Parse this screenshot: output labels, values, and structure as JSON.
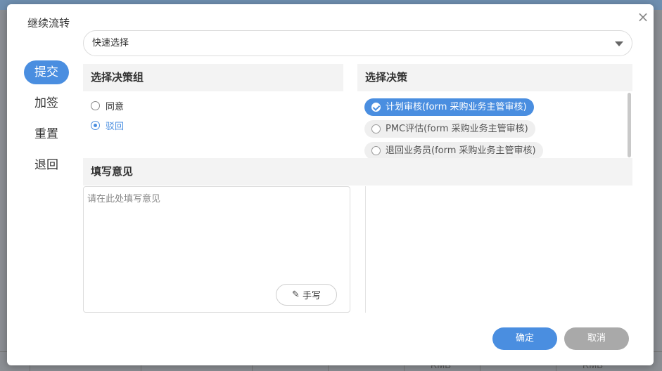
{
  "dialog": {
    "title": "继续流转",
    "close_glyph": "×"
  },
  "nav": {
    "items": [
      {
        "label": "提交",
        "active": true
      },
      {
        "label": "加签",
        "active": false
      },
      {
        "label": "重置",
        "active": false
      },
      {
        "label": "退回",
        "active": false
      }
    ]
  },
  "quick_select": {
    "value": "快速选择"
  },
  "decision_group": {
    "header": "选择决策组",
    "options": [
      {
        "label": "同意",
        "checked": false
      },
      {
        "label": "驳回",
        "checked": true
      }
    ]
  },
  "decision": {
    "header": "选择决策",
    "options": [
      {
        "label": "计划审核(form 采购业务主管审核)",
        "selected": true
      },
      {
        "label": "PMC评估(form 采购业务主管审核)",
        "selected": false
      },
      {
        "label": "退回业务员(form 采购业务主管审核)",
        "selected": false
      }
    ]
  },
  "opinion": {
    "header": "填写意见",
    "placeholder": "请在此处填写意见",
    "value": "",
    "handwrite_label": "手写"
  },
  "footer": {
    "ok_label": "确定",
    "cancel_label": "取消"
  },
  "background": {
    "rmb_label_1": "RMB",
    "rmb_label_2": "RMB"
  },
  "colors": {
    "accent": "#4a8ee0",
    "cancel": "#a9a9a9",
    "section_bg": "#f3f3f3"
  },
  "icons": {
    "close": "close-icon",
    "caret": "chevron-down-icon",
    "pen": "pen-icon",
    "check": "check-icon"
  }
}
